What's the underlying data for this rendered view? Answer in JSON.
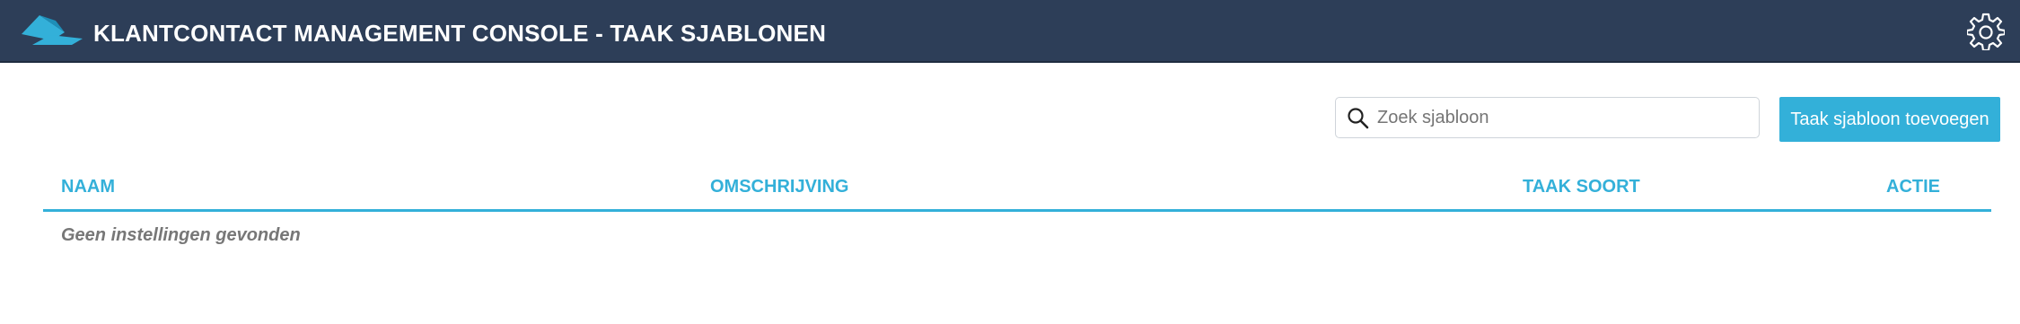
{
  "header": {
    "title": "KLANTCONTACT MANAGEMENT CONSOLE - TAAK SJABLONEN",
    "logo_icon": "logo-icon",
    "settings_icon": "gear-icon",
    "background_color": "#2d3e58"
  },
  "toolbar": {
    "search": {
      "placeholder": "Zoek sjabloon",
      "value": "",
      "icon": "search-icon"
    },
    "add_button_label": "Taak sjabloon toevoegen"
  },
  "table": {
    "columns": [
      "NAAM",
      "OMSCHRIJVING",
      "TAAK SOORT",
      "ACTIE"
    ],
    "rows": [],
    "empty_message": "Geen instellingen gevonden"
  },
  "colors": {
    "accent": "#33b0d9",
    "muted_text": "#777777"
  }
}
